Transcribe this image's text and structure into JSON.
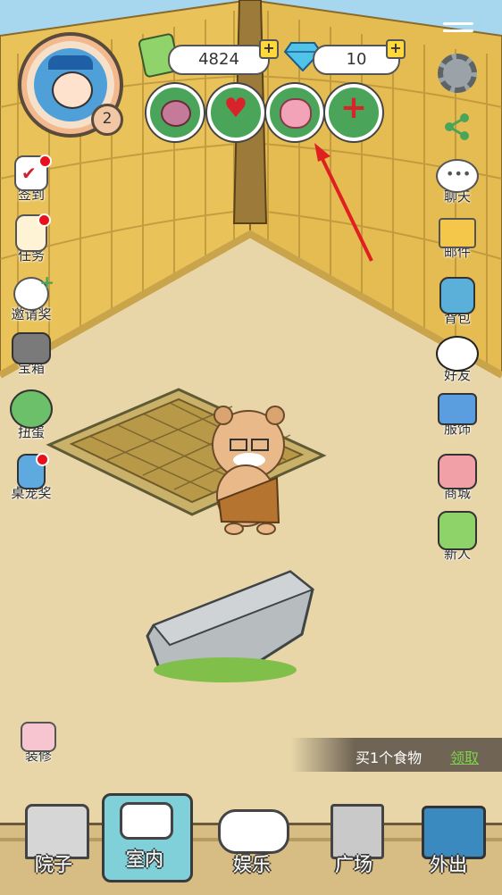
{
  "top": {
    "level": "2",
    "coins": "4824",
    "diamonds": "10"
  },
  "stats": [
    "meat-icon",
    "heart-icon",
    "brain-icon",
    "health-cross-icon"
  ],
  "left_menu": [
    {
      "label": "签到",
      "icon": "calendar-check-icon",
      "dot": true
    },
    {
      "label": "任务",
      "icon": "task-list-icon",
      "dot": true
    },
    {
      "label": "邀请奖",
      "icon": "invite-panda-icon",
      "dot": false
    },
    {
      "label": "宝箱",
      "icon": "treasure-chest-icon",
      "dot": false
    },
    {
      "label": "扭蛋",
      "icon": "gacha-machine-icon",
      "dot": false
    },
    {
      "label": "桌宠奖",
      "icon": "desktop-pet-icon",
      "dot": true
    }
  ],
  "right_menu": [
    {
      "label": "聊天",
      "icon": "chat-bubble-icon"
    },
    {
      "label": "邮件",
      "icon": "mail-icon"
    },
    {
      "label": "背包",
      "icon": "backpack-icon"
    },
    {
      "label": "好友",
      "icon": "friends-panda-icon"
    },
    {
      "label": "服饰",
      "icon": "clothing-icon"
    },
    {
      "label": "商城",
      "icon": "shop-icon"
    },
    {
      "label": "新人",
      "icon": "gift-icon"
    }
  ],
  "decorate": {
    "label": "装修"
  },
  "banner": {
    "text": "买1个食物",
    "action": "领取"
  },
  "nav": [
    {
      "label": "院子",
      "icon": "house-icon"
    },
    {
      "label": "室内",
      "icon": "pillow-icon",
      "active": true
    },
    {
      "label": "娱乐",
      "icon": "gamepad-icon"
    },
    {
      "label": "广场",
      "icon": "building-icon"
    },
    {
      "label": "外出",
      "icon": "graduation-cap-icon"
    }
  ],
  "colors": {
    "sky": "#a7d6ef",
    "straw": "#e9c35a",
    "floor": "#e8d6a8",
    "accent": "#4aa55a",
    "red": "#e8101b"
  }
}
